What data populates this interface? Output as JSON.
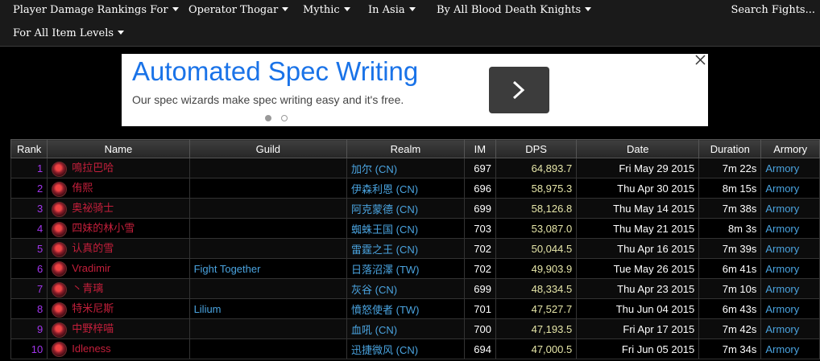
{
  "filters": {
    "row1": [
      "Player Damage Rankings For",
      "Operator Thogar",
      "Mythic",
      "In Asia",
      "By All Blood Death Knights"
    ],
    "row2": [
      "For All Item Levels"
    ],
    "search_label": "Search Fights..."
  },
  "ad": {
    "title": "Automated Spec Writing",
    "subtitle": "Our spec wizards make spec writing easy and it's free.",
    "button_icon": "chevron-right-icon",
    "close_icon": "close-icon"
  },
  "table": {
    "headers": [
      "Rank",
      "Name",
      "Guild",
      "Realm",
      "IM",
      "DPS",
      "Date",
      "Duration",
      "Armory"
    ],
    "rows": [
      {
        "rank": "1",
        "name": "鳴拉巴哈",
        "guild": "",
        "realm": "加尔 (CN)",
        "im": "697",
        "dps": "64,893.7",
        "date": "Fri May 29 2015",
        "duration": "7m 22s",
        "armory": "Armory"
      },
      {
        "rank": "2",
        "name": "侑熙",
        "guild": "",
        "realm": "伊森利恩 (CN)",
        "im": "696",
        "dps": "58,975.3",
        "date": "Thu Apr 30 2015",
        "duration": "8m 15s",
        "armory": "Armory"
      },
      {
        "rank": "3",
        "name": "奥祕骑士",
        "guild": "",
        "realm": "阿克蒙德 (CN)",
        "im": "699",
        "dps": "58,126.8",
        "date": "Thu May 14 2015",
        "duration": "7m 38s",
        "armory": "Armory"
      },
      {
        "rank": "4",
        "name": "四妹的林小雪",
        "guild": "",
        "realm": "蜘蛛王国 (CN)",
        "im": "703",
        "dps": "53,087.0",
        "date": "Thu May 21 2015",
        "duration": "8m 3s",
        "armory": "Armory"
      },
      {
        "rank": "5",
        "name": "认真的雪",
        "guild": "",
        "realm": "雷霆之王 (CN)",
        "im": "702",
        "dps": "50,044.5",
        "date": "Thu Apr 16 2015",
        "duration": "7m 39s",
        "armory": "Armory"
      },
      {
        "rank": "6",
        "name": "Vradimir",
        "guild": "Fight Together",
        "realm": "日落沼澤 (TW)",
        "im": "702",
        "dps": "49,903.9",
        "date": "Tue May 26 2015",
        "duration": "6m 41s",
        "armory": "Armory"
      },
      {
        "rank": "7",
        "name": "丶青璃",
        "guild": "",
        "realm": "灰谷 (CN)",
        "im": "699",
        "dps": "48,334.5",
        "date": "Thu Apr 23 2015",
        "duration": "7m 10s",
        "armory": "Armory"
      },
      {
        "rank": "8",
        "name": "特米尼斯",
        "guild": "Lilium",
        "realm": "憤怒使者 (TW)",
        "im": "701",
        "dps": "47,527.7",
        "date": "Thu Jun 04 2015",
        "duration": "6m 43s",
        "armory": "Armory"
      },
      {
        "rank": "9",
        "name": "中野梓喵",
        "guild": "",
        "realm": "血吼 (CN)",
        "im": "700",
        "dps": "47,193.5",
        "date": "Fri Apr 17 2015",
        "duration": "7m 42s",
        "armory": "Armory"
      },
      {
        "rank": "10",
        "name": "Idleness",
        "guild": "",
        "realm": "迅捷微风 (CN)",
        "im": "694",
        "dps": "47,000.5",
        "date": "Fri Jun 05 2015",
        "duration": "7m 34s",
        "armory": "Armory"
      }
    ]
  }
}
